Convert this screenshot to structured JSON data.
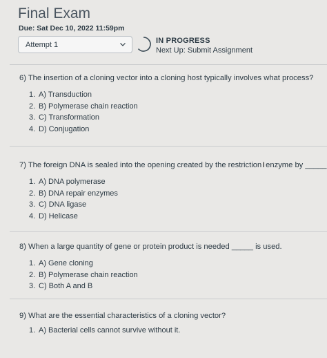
{
  "header": {
    "title": "Final Exam",
    "due": "Due: Sat Dec 10, 2022 11:59pm",
    "attempt_select": "Attempt 1",
    "status": "IN PROGRESS",
    "next_up": "Next Up: Submit Assignment"
  },
  "questions": [
    {
      "text": "6) The insertion of a cloning vector into a cloning host typically involves what process?",
      "options": [
        {
          "num": "1.",
          "label": "A) Transduction"
        },
        {
          "num": "2.",
          "label": "B) Polymerase chain reaction"
        },
        {
          "num": "3.",
          "label": "C) Transformation"
        },
        {
          "num": "4.",
          "label": "D) Conjugation"
        }
      ]
    },
    {
      "text_before": "7) The foreign DNA is sealed into the opening created by the restriction",
      "cursor": "I",
      "text_after": "enzyme by _____.",
      "options": [
        {
          "num": "1.",
          "label": "A) DNA polymerase"
        },
        {
          "num": "2.",
          "label": "B) DNA repair enzymes"
        },
        {
          "num": "3.",
          "label": "C) DNA ligase"
        },
        {
          "num": "4.",
          "label": "D) Helicase"
        }
      ]
    },
    {
      "text": "8) When a large quantity of gene or protein product is needed _____ is used.",
      "options": [
        {
          "num": "1.",
          "label": "A) Gene cloning"
        },
        {
          "num": "2.",
          "label": "B) Polymerase chain reaction"
        },
        {
          "num": "3.",
          "label": "C) Both A and B"
        }
      ]
    },
    {
      "text": "9) What are the essential characteristics of a cloning vector?",
      "options": [
        {
          "num": "1.",
          "label": "A) Bacterial cells cannot survive without it."
        }
      ]
    }
  ],
  "colors": {
    "background": "#e9e8e6",
    "text": "#2d3b45",
    "progress_ring": "#3a4a55"
  },
  "icons": [
    "chevron-down-icon",
    "progress-ring-icon",
    "text-cursor-icon"
  ]
}
